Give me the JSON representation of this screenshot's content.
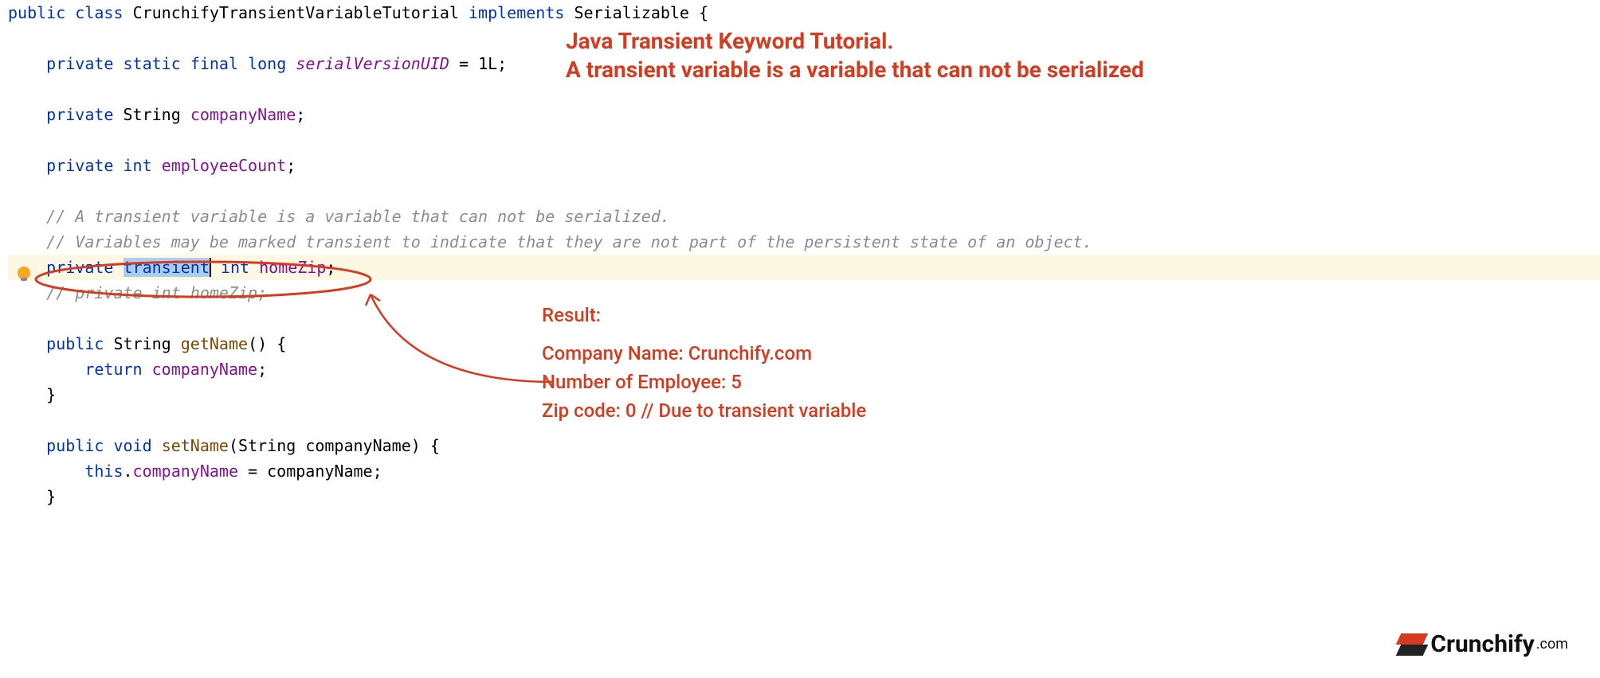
{
  "code": {
    "kw_public": "public",
    "kw_class": "class",
    "class_name": "CrunchifyTransientVariableTutorial",
    "kw_implements": "implements",
    "iface": "Serializable",
    "brace_open": "{",
    "kw_private": "private",
    "kw_static": "static",
    "kw_final": "final",
    "kw_long": "long",
    "serialVersionUID": "serialVersionUID",
    "eq1L": " = 1L;",
    "type_String": "String",
    "field_companyName": "companyName",
    "semi": ";",
    "kw_int": "int",
    "field_employeeCount": "employeeCount",
    "comment1": "// A transient variable is a variable that can not be serialized.",
    "comment2": "// Variables may be marked transient to indicate that they are not part of the persistent state of an object.",
    "kw_transient": "transient",
    "field_homeZip": "homeZip",
    "comment3": "// private int homeZip;",
    "method_getName": "getName",
    "paren_empty": "()",
    "brace_open2": " {",
    "kw_return": "return",
    "brace_close": "}",
    "kw_void": "void",
    "method_setName": "setName",
    "param_open": "(String companyName) {",
    "kw_this": "this",
    "dot": ".",
    "eq_assign": " = companyName;"
  },
  "annotation": {
    "title_line1": "Java Transient Keyword Tutorial.",
    "title_line2": " A transient variable is a variable that can not be serialized",
    "result_heading": "Result:",
    "result_line1": "Company Name: Crunchify.com",
    "result_line2": "Number of Employee: 5",
    "result_line3": "Zip code: 0 // Due to transient variable"
  },
  "logo": {
    "text": "Crunchify",
    "suffix": ".com"
  }
}
